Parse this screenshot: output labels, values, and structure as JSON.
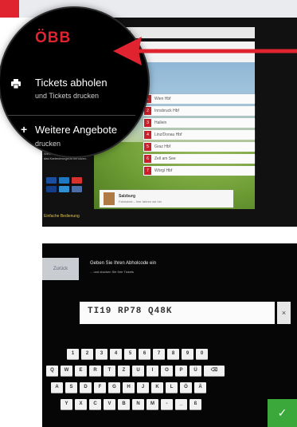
{
  "screen1": {
    "brand": "ÖBB",
    "lens": {
      "item1_title": "Tickets abholen",
      "item1_sub": "und Tickets drucken",
      "item2_title": "Weitere Angebote",
      "item2_sub": "drucken"
    },
    "header_text": "Bahnhof: Wien Hbf",
    "search_placeholder": "Reise: Ziel hier angeben",
    "stations": [
      {
        "num": "1",
        "label": "Wien Hbf"
      },
      {
        "num": "2",
        "label": "Innsbruck Hbf"
      },
      {
        "num": "3",
        "label": "Hallein"
      },
      {
        "num": "4",
        "label": "Linz/Donau Hbf"
      },
      {
        "num": "5",
        "label": "Graz Hbf"
      },
      {
        "num": "6",
        "label": "Zell am See"
      },
      {
        "num": "7",
        "label": "Wörgl Hbf"
      }
    ],
    "bottom_station": {
      "title": "Salzburg",
      "subtitle": "Fahrtziele – hier fahren wir hin"
    },
    "note": "Wenn Sie mit Karte bezahlen, bitte das Kartenlesegerät benutzen.",
    "payments": [
      {
        "name": "visa-icon",
        "color": "#1a4fa0"
      },
      {
        "name": "maestro-icon",
        "color": "#1e78c2"
      },
      {
        "name": "mastercard-icon",
        "color": "#d8322f"
      },
      {
        "name": "vpay-icon",
        "color": "#153e88"
      },
      {
        "name": "amex-icon",
        "color": "#2f8fd5"
      },
      {
        "name": "diners-icon",
        "color": "#4a6fa8"
      }
    ],
    "footer_link": "Einfache Bedienung"
  },
  "screen2": {
    "back_label": "Zurück",
    "instruction": "Geben Sie Ihren Abholcode ein",
    "instruction_sub": "... und drucken Sie Ihre Tickets",
    "code_value": "TI19 RP78 Q48K",
    "clear_label": "×",
    "ok_label": "✓",
    "keys": {
      "row1": [
        "1",
        "2",
        "3",
        "4",
        "5",
        "6",
        "7",
        "8",
        "9",
        "0"
      ],
      "row2": [
        "Q",
        "W",
        "E",
        "R",
        "T",
        "Z",
        "U",
        "I",
        "O",
        "P",
        "Ü",
        "⌫"
      ],
      "row3": [
        "A",
        "S",
        "D",
        "F",
        "G",
        "H",
        "J",
        "K",
        "L",
        "Ö",
        "Ä"
      ],
      "row4": [
        "Y",
        "X",
        "C",
        "V",
        "B",
        "N",
        "M",
        "-",
        "_",
        "ß"
      ]
    }
  },
  "colors": {
    "brand_red": "#e0242f",
    "ok_green": "#3aa83a"
  }
}
